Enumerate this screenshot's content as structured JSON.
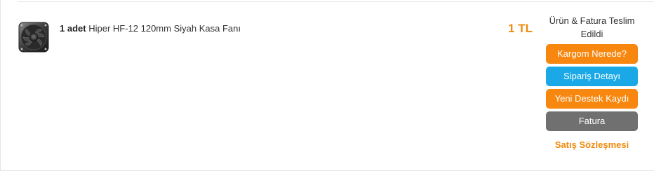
{
  "order_item": {
    "quantity": "1 adet",
    "product_name": "Hiper HF-12 120mm Siyah Kasa Fanı",
    "product_icon": "case-fan-image",
    "price": "1 TL"
  },
  "status": {
    "text": "Ürün & Fatura Teslim Edildi"
  },
  "actions": {
    "track_cargo": "Kargom Nerede?",
    "order_detail": "Sipariş Detayı",
    "new_support": "Yeni Destek Kaydı",
    "invoice": "Fatura",
    "sales_contract": "Satış Sözleşmesi"
  },
  "colors": {
    "accent_orange": "#f7870f",
    "accent_blue": "#1aa9e6",
    "button_gray": "#707070",
    "price_orange": "#f08a0c"
  }
}
